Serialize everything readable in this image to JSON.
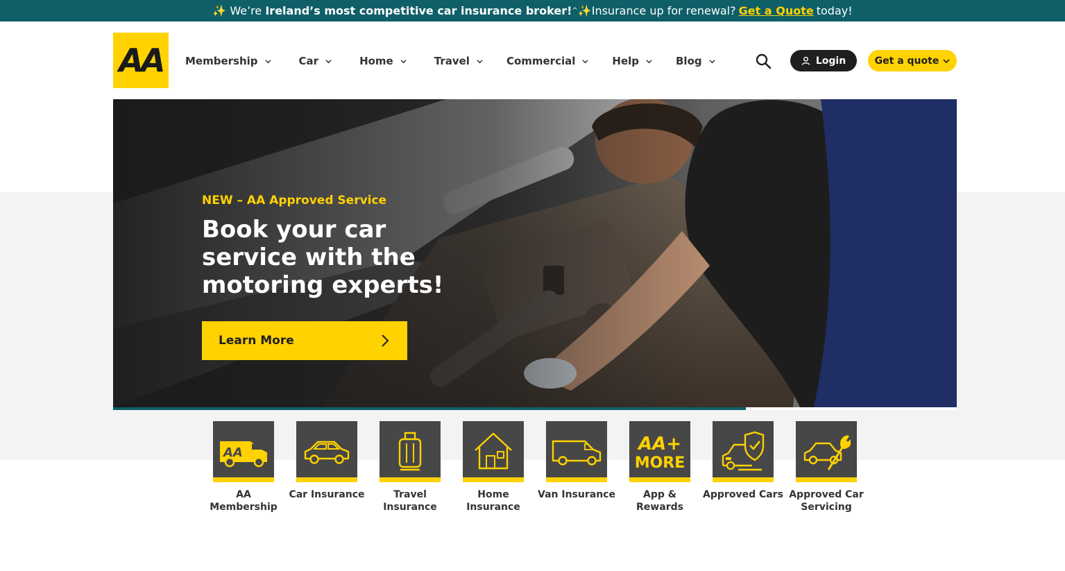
{
  "colors": {
    "brand_yellow": "#ffd200",
    "teal": "#0f5f68",
    "dark": "#1f1f1f",
    "tile_grey": "#474747"
  },
  "promo": {
    "spark_left": "✨",
    "text_1": " We’re ",
    "bold": "Ireland’s most competitive car insurance broker!",
    "sup": "^",
    "spark_mid": "✨",
    "text_2": "Insurance up for renewal?",
    "cta": "Get a Quote",
    "text_3": "today!"
  },
  "header": {
    "logo_text": "AA",
    "nav": [
      {
        "label": "Membership",
        "icon": "chevron-down-icon"
      },
      {
        "label": "Car",
        "icon": "chevron-down-icon"
      },
      {
        "label": "Home",
        "icon": "chevron-down-icon"
      },
      {
        "label": "Travel",
        "icon": "chevron-down-icon"
      },
      {
        "label": "Commercial",
        "icon": "chevron-down-icon"
      },
      {
        "label": "Help",
        "icon": "chevron-down-icon"
      },
      {
        "label": "Blog",
        "icon": "chevron-down-icon"
      }
    ],
    "search_icon": "search-icon",
    "login_label": "Login",
    "quote_label": "Get a quote"
  },
  "hero": {
    "tag": "NEW – AA Approved Service",
    "title": "Book your car service with the motoring experts!",
    "button_label": "Learn More",
    "carousel_progress": 0.75
  },
  "tiles": [
    {
      "label": "AA Membership",
      "icon": "aa-van-icon"
    },
    {
      "label": "Car Insurance",
      "icon": "car-icon"
    },
    {
      "label": "Travel Insurance",
      "icon": "suitcase-icon"
    },
    {
      "label": "Home Insurance",
      "icon": "house-icon"
    },
    {
      "label": "Van Insurance",
      "icon": "van-icon"
    },
    {
      "label": "App & Rewards",
      "icon": "aa-plus-more-icon"
    },
    {
      "label": "Approved Cars",
      "icon": "shield-car-icon"
    },
    {
      "label": "Approved Car Servicing",
      "icon": "car-wrench-icon"
    }
  ],
  "tile_art": {
    "aa_van_text": "AA",
    "aa_plus_line1": "AA+",
    "aa_plus_line2": "MORE"
  }
}
